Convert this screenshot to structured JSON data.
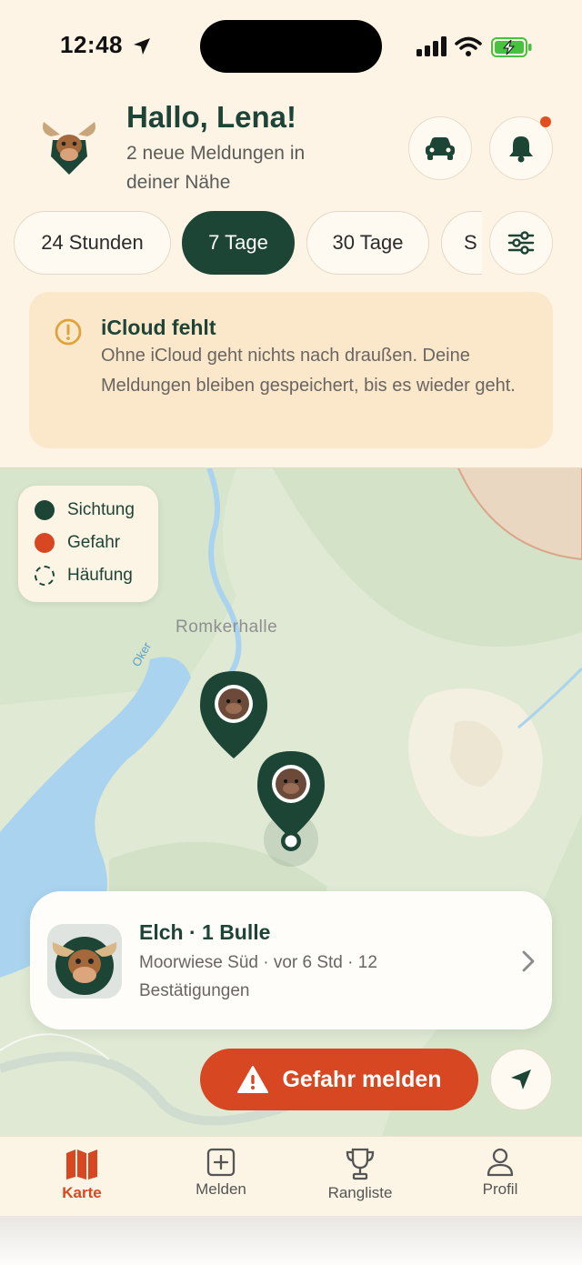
{
  "status_bar": {
    "time": "12:48"
  },
  "header": {
    "greeting": "Hallo, Lena!",
    "subtitle": "2 neue Meldungen in deiner Nähe"
  },
  "filters": {
    "chips": [
      "24 Stunden",
      "7 Tage",
      "30 Tage",
      "S"
    ],
    "active_chip": "7 Tage"
  },
  "alert": {
    "title": "iCloud fehlt",
    "body": "Ohne iCloud geht nichts nach draußen. Deine Meldungen bleiben gespeichert, bis es wieder geht."
  },
  "map": {
    "legend": [
      {
        "label": "Sichtung",
        "color": "#1c4536",
        "style": "filled"
      },
      {
        "label": "Gefahr",
        "color": "#d64722",
        "style": "filled"
      },
      {
        "label": "Häufung",
        "color": "#1c4536",
        "style": "dashed"
      }
    ],
    "place_label": "Romkerhalle",
    "river_label": "Oker"
  },
  "sighting": {
    "title": "Elch · 1 Bulle",
    "meta": "Moorwiese Süd · vor 6 Std · 12 Bestätigungen"
  },
  "actions": {
    "report_label": "Gefahr melden"
  },
  "tabbar": {
    "tabs": [
      {
        "label": "Karte",
        "icon": "map-icon",
        "active": true
      },
      {
        "label": "Melden",
        "icon": "plus-square-icon",
        "active": false
      },
      {
        "label": "Rangliste",
        "icon": "trophy-icon",
        "active": false
      },
      {
        "label": "Profil",
        "icon": "person-icon",
        "active": false
      }
    ]
  },
  "colors": {
    "brand_green": "#1c4536",
    "danger_orange": "#d64722",
    "background": "#fdf4e6",
    "warning_bg": "#fbe8cb"
  }
}
